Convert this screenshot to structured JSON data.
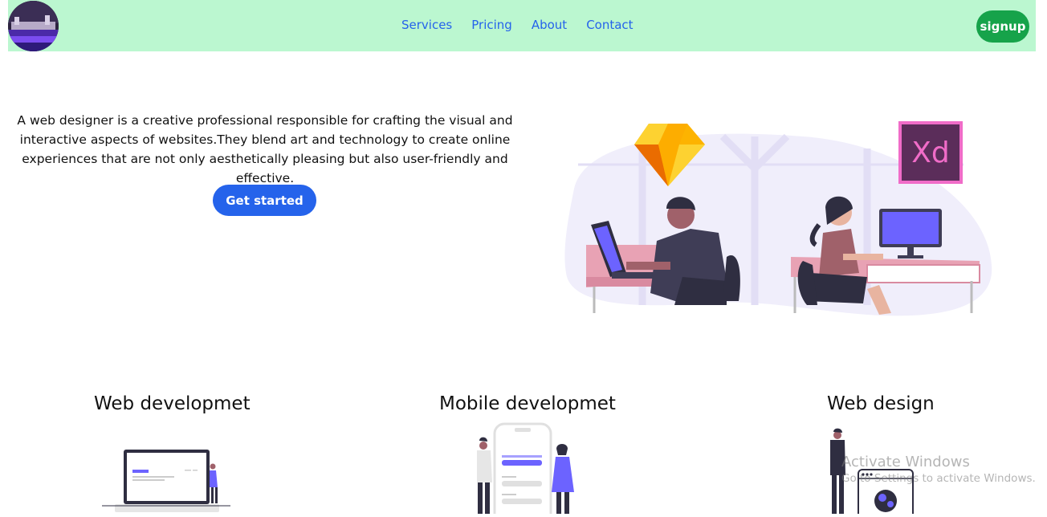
{
  "header": {
    "nav": [
      "Services",
      "Pricing",
      "About",
      "Contact"
    ],
    "signup_label": "signup"
  },
  "hero": {
    "description": "A web designer is a creative professional responsible for crafting the visual and interactive aspects of websites.They blend art and technology to create online experiences that are not only aesthetically pleasing but also user-friendly and effective.",
    "cta_label": "Get started",
    "xd_logo_text": "Xd"
  },
  "services": [
    {
      "title": "Web developmet"
    },
    {
      "title": "Mobile developmet"
    },
    {
      "title": "Web design"
    }
  ],
  "overlay": {
    "activate_title": "Activate Windows",
    "activate_sub": "Go to Settings to activate Windows."
  },
  "colors": {
    "navbar_bg": "#bbf7d0",
    "nav_link": "#2563eb",
    "signup_bg": "#16a34a",
    "cta_bg": "#2563eb",
    "illustration_accent": "#6c63ff"
  }
}
